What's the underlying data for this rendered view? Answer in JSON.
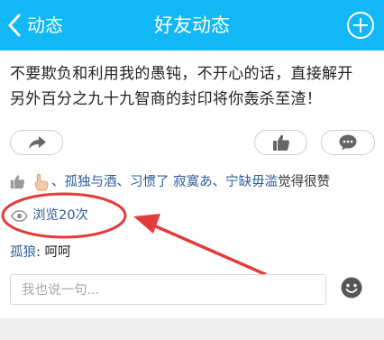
{
  "header": {
    "back_label": "动态",
    "title": "好友动态",
    "bg_color": "#12b7f5"
  },
  "post": {
    "text_line1": "不要欺负和利用我的愚钝，不开心的话，直接解开",
    "text_line2": "另外百分之九十九智商的封印将你轰杀至渣！"
  },
  "likes": {
    "names": [
      "、孤独与酒",
      "、习惯了 寂寞あ",
      "、宁缺毋滥"
    ],
    "suffix": "觉得很赞"
  },
  "views": {
    "label": "浏览20次"
  },
  "comments": [
    {
      "author": "孤狼",
      "separator": ": ",
      "text": "呵呵"
    }
  ],
  "input": {
    "placeholder": "我也说一句..."
  },
  "colors": {
    "link": "#2f5c99",
    "annotation": "#e33b3b"
  }
}
